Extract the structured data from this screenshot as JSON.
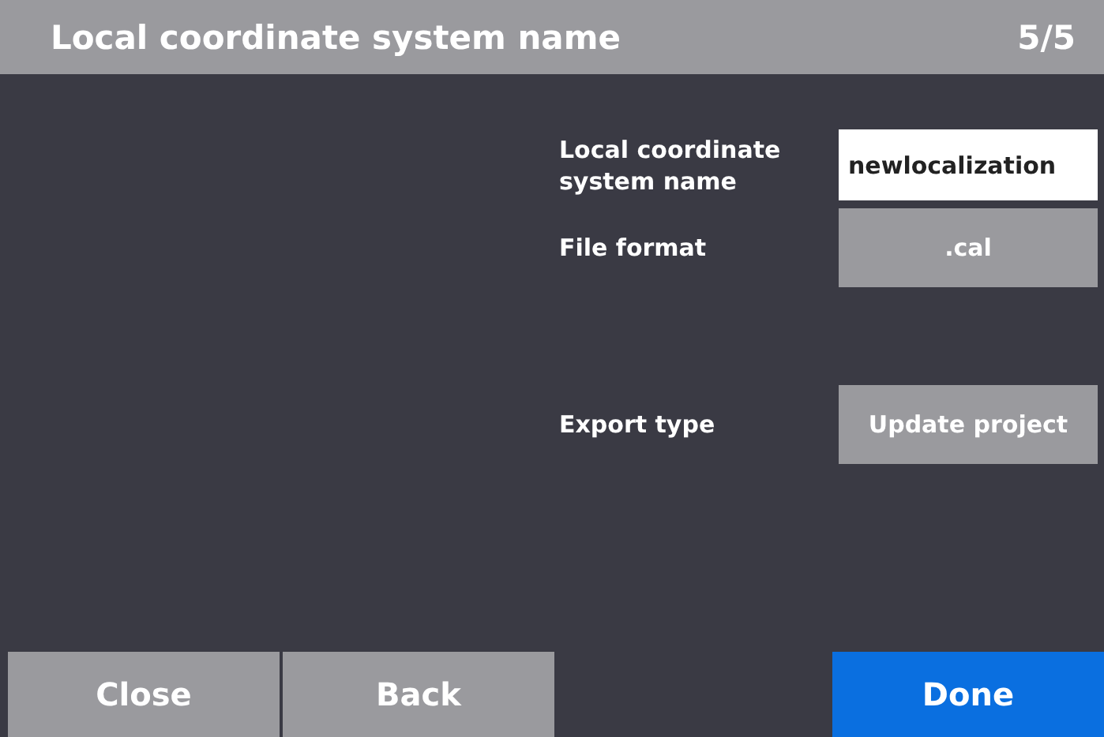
{
  "header": {
    "title": "Local coordinate system name",
    "step": "5/5"
  },
  "fields": [
    {
      "kind": "input",
      "label": "Local coordinate system name",
      "value": "newlocalization"
    },
    {
      "kind": "select",
      "label": "File format",
      "value": ".cal"
    },
    {
      "kind": "spacer"
    },
    {
      "kind": "select",
      "label": "Export type",
      "value": "Update project"
    }
  ],
  "buttons": [
    {
      "label": "Close",
      "kind": "secondary"
    },
    {
      "label": "Back",
      "kind": "secondary"
    },
    {
      "kind": "gap"
    },
    {
      "label": "Done",
      "kind": "primary"
    }
  ]
}
